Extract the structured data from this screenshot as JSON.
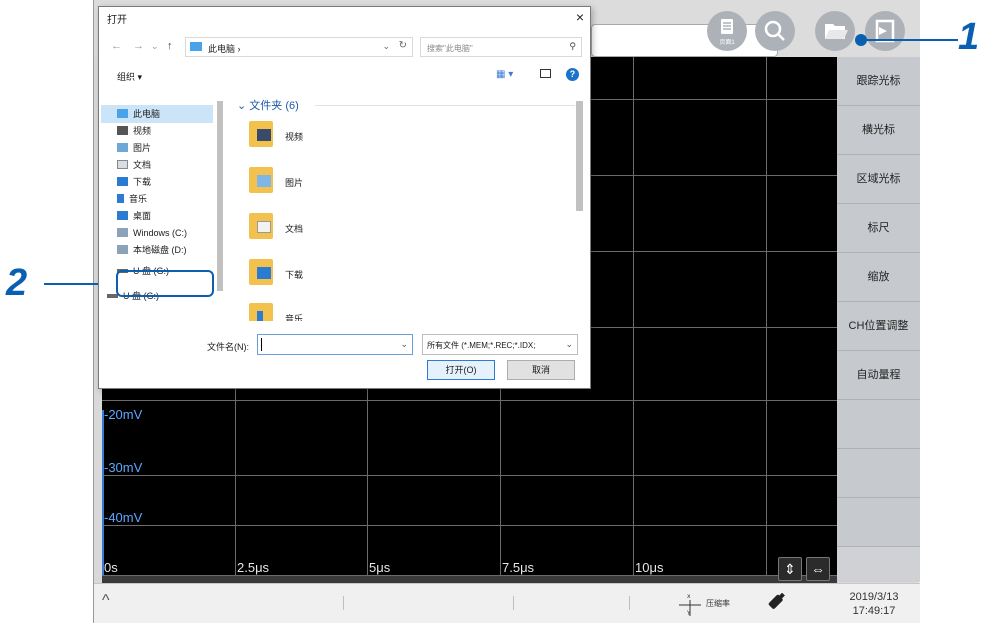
{
  "toolbar": {
    "dropdown_value": "",
    "page_button_label": "页面1",
    "icons": [
      "page-icon",
      "zoom-icon",
      "open-folder-icon",
      "export-icon"
    ]
  },
  "plot": {
    "y_labels": [
      "-20mV",
      "-30mV",
      "-40mV"
    ],
    "x_labels": [
      "0s",
      "2.5μs",
      "5μs",
      "7.5μs",
      "10μs"
    ]
  },
  "sidebar": {
    "buttons": [
      "跟踪光标",
      "横光标",
      "区域光标",
      "标尺",
      "缩放",
      "CH位置调整",
      "自动量程"
    ]
  },
  "statusbar": {
    "caret": "^",
    "zoom_label": "压缩率",
    "date": "2019/3/13",
    "time": "17:49:17"
  },
  "dialog": {
    "title": "打开",
    "close": "×",
    "address": "此电脑 ›",
    "address_prefix": "›",
    "search_placeholder": "搜索\"此电脑\"",
    "organize": "组织 ▾",
    "nav_items": [
      {
        "label": "此电脑",
        "icon": "pc-icon"
      },
      {
        "label": "视频",
        "icon": "video-icon"
      },
      {
        "label": "图片",
        "icon": "picture-icon"
      },
      {
        "label": "文档",
        "icon": "document-icon"
      },
      {
        "label": "下载",
        "icon": "download-icon"
      },
      {
        "label": "音乐",
        "icon": "music-icon"
      },
      {
        "label": "桌面",
        "icon": "desktop-icon"
      },
      {
        "label": "Windows (C:)",
        "icon": "drive-icon"
      },
      {
        "label": "本地磁盘 (D:)",
        "icon": "drive-icon"
      },
      {
        "label": "U 盘 (G:)",
        "icon": "usb-drive-icon"
      },
      {
        "label": "U 盘 (G:)",
        "icon": "usb-drive-icon"
      }
    ],
    "folder_header": "文件夹 (6)",
    "folders": [
      {
        "label": "视频",
        "icon": "video-folder-icon"
      },
      {
        "label": "图片",
        "icon": "picture-folder-icon"
      },
      {
        "label": "文档",
        "icon": "document-folder-icon"
      },
      {
        "label": "下载",
        "icon": "download-folder-icon"
      },
      {
        "label": "音乐",
        "icon": "music-folder-icon"
      }
    ],
    "filename_label": "文件名(N):",
    "filename_value": "",
    "filetype": "所有文件 (*.MEM;*.REC;*.IDX;",
    "open_button": "打开(O)",
    "cancel_button": "取消"
  },
  "callouts": {
    "one": "1",
    "two": "2"
  },
  "colors": {
    "callout": "#0b5fb0",
    "plot_background": "#000000",
    "axis_label": "#5aa8ff",
    "selection": "#cce4f7"
  }
}
